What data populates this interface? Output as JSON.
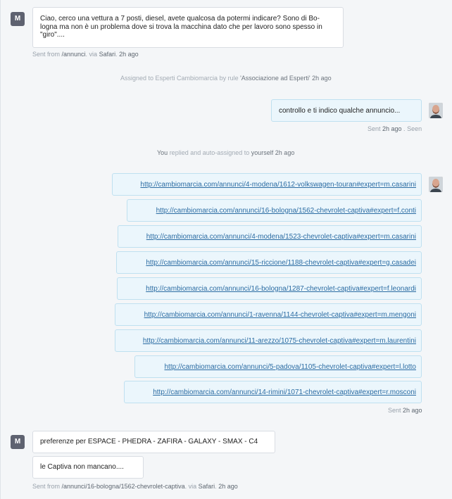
{
  "messages": {
    "first": {
      "avatar_letter": "M",
      "text": "Ciao, cerco una vettura a 7 posti, diesel, avete qualcosa da potermi indicare? Sono di Bo-logna ma non è un problema dove si trova la macchina dato che per lavoro sono spesso in \"giro\"....",
      "meta": {
        "prefix": "Sent from ",
        "source": "/annunci",
        "via": ". via ",
        "browser": "Safari",
        "sep": ". ",
        "time": "2h ago"
      }
    },
    "assign_event": {
      "prefix": "Assigned to ",
      "target": "Esperti Cambiomarcia",
      "by": " by rule ",
      "rule": "'Associazione ad Esperti'",
      "time": " 2h ago"
    },
    "agent_reply": {
      "text": "controllo e ti indico qualche annuncio...",
      "meta": {
        "prefix": "Sent ",
        "time": "2h ago",
        "sep": " . ",
        "status": "Seen"
      }
    },
    "reply_event": {
      "actor": "You",
      "action": " replied and auto-assigned to ",
      "target": "yourself",
      "time": " 2h ago"
    },
    "links": [
      "http://cambiomarcia.com/annunci/4-modena/1612-volkswagen-touran#expert=m.casarini",
      "http://cambiomarcia.com/annunci/16-bologna/1562-chevrolet-captiva#expert=f.conti",
      "http://cambiomarcia.com/annunci/4-modena/1523-chevrolet-captiva#expert=m.casarini",
      "http://cambiomarcia.com/annunci/15-riccione/1188-chevrolet-captiva#expert=g.casadei",
      "http://cambiomarcia.com/annunci/16-bologna/1287-chevrolet-captiva#expert=f.leonardi",
      "http://cambiomarcia.com/annunci/1-ravenna/1144-chevrolet-captiva#expert=m.mengoni",
      "http://cambiomarcia.com/annunci/11-arezzo/1075-chevrolet-captiva#expert=m.laurentini",
      "http://cambiomarcia.com/annunci/5-padova/1105-chevrolet-captiva#expert=l.lotto",
      "http://cambiomarcia.com/annunci/14-rimini/1071-chevrolet-captiva#expert=r.mosconi"
    ],
    "links_meta": {
      "prefix": "Sent ",
      "time": "2h ago"
    },
    "second": {
      "avatar_letter": "M",
      "text1": "preferenze per ESPACE - PHEDRA - ZAFIRA - GALAXY - SMAX - C4",
      "text2": "le Captiva non mancano....",
      "meta": {
        "prefix": "Sent from ",
        "source": "/annunci/16-bologna/1562-chevrolet-captiva",
        "via": ". via ",
        "browser": "Safari",
        "sep": ". ",
        "time": "2h ago"
      }
    }
  },
  "colors": {
    "link": "#2b6ca3",
    "outgoing_bg": "#ebf6fc",
    "avatar_bg": "#5e6270"
  }
}
